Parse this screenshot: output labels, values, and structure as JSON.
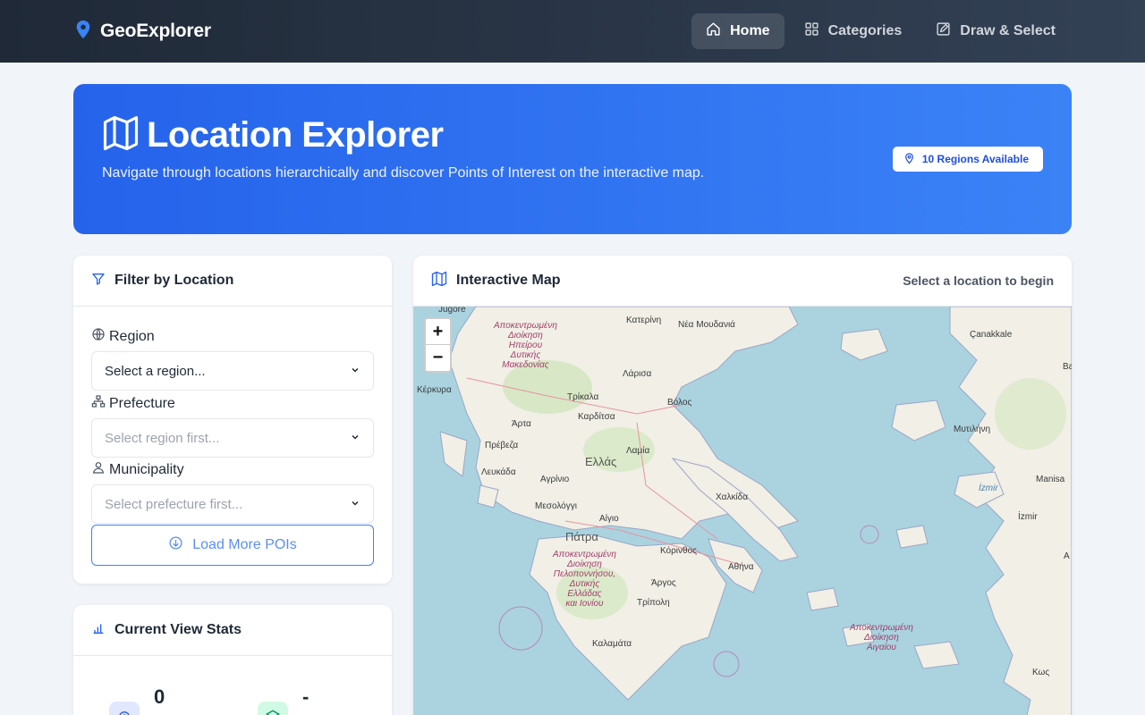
{
  "nav": {
    "brand": "GeoExplorer",
    "links": [
      {
        "label": "Home",
        "icon": "home-icon",
        "active": true
      },
      {
        "label": "Categories",
        "icon": "grid-icon",
        "active": false
      },
      {
        "label": "Draw & Select",
        "icon": "edit-icon",
        "active": false
      }
    ]
  },
  "hero": {
    "title": "Location Explorer",
    "description": "Navigate through locations hierarchically and discover Points of Interest on the interactive map.",
    "badge": "10 Regions Available"
  },
  "filter": {
    "title": "Filter by Location",
    "region_label": "Region",
    "region_value": "Select a region...",
    "prefecture_label": "Prefecture",
    "prefecture_value": "Select region first...",
    "municipality_label": "Municipality",
    "municipality_value": "Select prefecture first...",
    "load_more": "Load More POIs"
  },
  "stats": {
    "title": "Current View Stats",
    "poi_count": "0",
    "layer_value": "-"
  },
  "map": {
    "title": "Interactive Map",
    "status": "Select a location to begin",
    "zoom_in": "+",
    "zoom_out": "−",
    "labels": {
      "jugore": "Jugore",
      "katerini": "Κατερίνη",
      "nea_moudania": "Νέα Μουδανιά",
      "admin_ipeiros": "Αποκεντρωμένη\nΔιοίκηση\nΗπείρου\nΔυτικής\nΜακεδονίας",
      "kerkyra": "Κέρκυρα",
      "larisa": "Λάρισα",
      "trikala": "Τρίκαλα",
      "volos": "Βόλος",
      "karditsa": "Καρδίτσα",
      "arta": "Άρτα",
      "preveza": "Πρέβεζα",
      "lamia": "Λαμία",
      "ellas": "Ελλάς",
      "lefkada": "Λευκάδα",
      "agrinio": "Αγρίνιο",
      "chalkida": "Χαλκίδα",
      "mesolongi": "Μεσολόγγι",
      "aigio": "Αίγιο",
      "patra": "Πάτρα",
      "korinthos": "Κόρινθος",
      "athina": "Αθήνα",
      "admin_peloponnisou": "Αποκεντρωμένη\nΔιοίκηση\nΠελοποννήσου,\nΔυτικής\nΕλλάδας\nκαι Ιονίου",
      "argos": "Άργος",
      "tripoli": "Τρίπολη",
      "kalamata": "Καλαμάτα",
      "admin_aigaiou": "Αποκεντρωμένη\nΔιοίκηση\nΑιγαίου",
      "canakkale": "Çanakkale",
      "mytilini": "Μυτιλήνη",
      "izmir_sea": "İzmir",
      "manisa": "Manisa",
      "izmir": "İzmir",
      "kos": "Κως",
      "b": "B",
      "ba": "Ba",
      "a": "A"
    }
  }
}
